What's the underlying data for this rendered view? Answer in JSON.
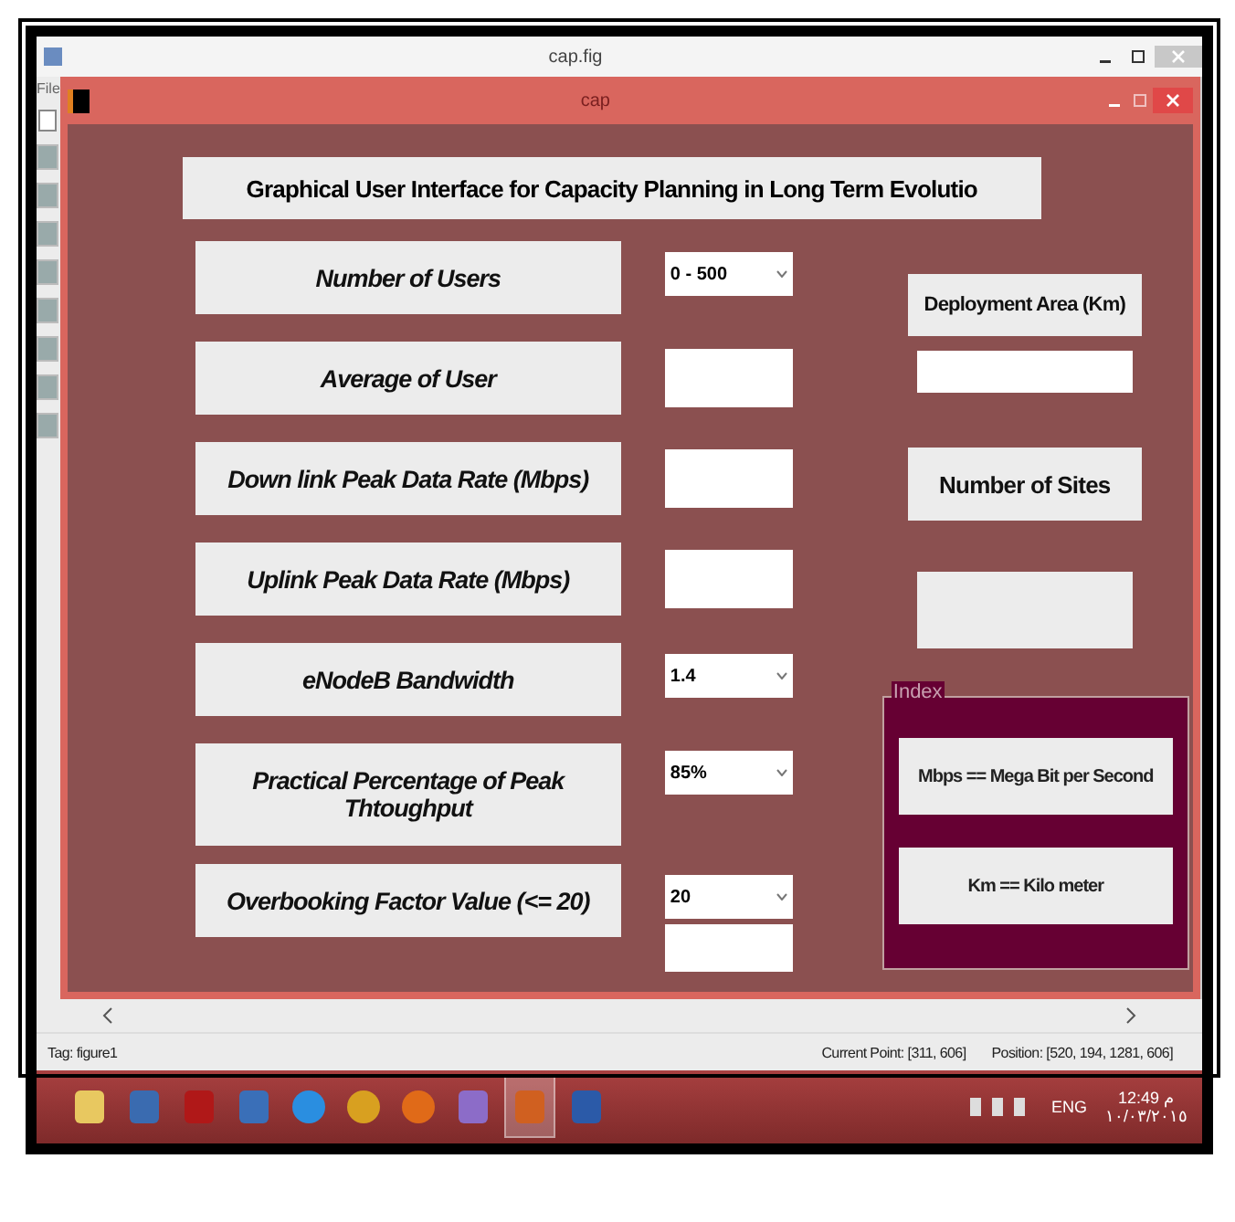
{
  "window": {
    "title": "cap.fig",
    "menu": [
      "File"
    ]
  },
  "figure": {
    "title": "cap",
    "heading": "Graphical User Interface for Capacity Planning in Long Term Evolutio",
    "fields": [
      {
        "label": "Number of Users",
        "kind": "popup",
        "value": "0 - 500"
      },
      {
        "label": "Average of User",
        "kind": "edit"
      },
      {
        "label": "Down link Peak Data Rate (Mbps)",
        "kind": "edit"
      },
      {
        "label": "Uplink Peak Data Rate (Mbps)",
        "kind": "edit"
      },
      {
        "label": "eNodeB Bandwidth",
        "kind": "popup",
        "value": "1.4"
      },
      {
        "label": "Practical Percentage of Peak Thtoughput",
        "kind": "popup",
        "value": "85%"
      },
      {
        "label": "Overbooking Factor Value (<= 20)",
        "kind": "popup",
        "value": "20"
      }
    ],
    "deployment_label": "Deployment Area (Km)",
    "sites_label": "Number of Sites",
    "index": {
      "title": "Index",
      "items": [
        "Mbps == Mega Bit per Second",
        "Km == Kilo meter"
      ]
    }
  },
  "status_bar": {
    "tag": "Tag: figure1",
    "current_point": "Current Point: [311, 606]",
    "position": "Position: [520, 194, 1281, 606]"
  },
  "taskbar": {
    "apps": [
      {
        "kind": "folder",
        "selected": false
      },
      {
        "kind": "monitor",
        "selected": false
      },
      {
        "kind": "red",
        "selected": false
      },
      {
        "kind": "doc",
        "selected": false
      },
      {
        "kind": "ie",
        "selected": false
      },
      {
        "kind": "chrome",
        "selected": false
      },
      {
        "kind": "firefox",
        "selected": false
      },
      {
        "kind": "vs",
        "selected": false
      },
      {
        "kind": "matlab",
        "selected": true
      },
      {
        "kind": "word",
        "selected": false
      }
    ],
    "language": "ENG",
    "time": "12:49 م",
    "date": "١٠/٠٣/٢٠١٥"
  }
}
